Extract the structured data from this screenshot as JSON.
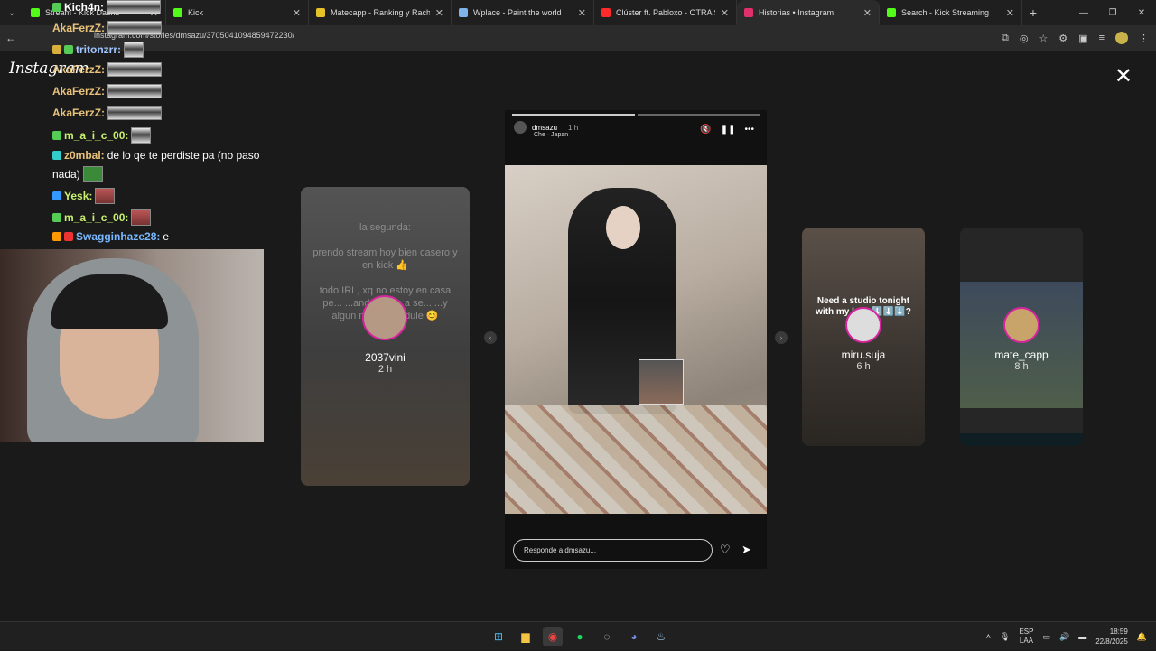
{
  "browser": {
    "tabs": [
      {
        "title": "Stream - Kick Dashb",
        "favicon_color": "#53fc18",
        "active": false
      },
      {
        "title": "Kick",
        "favicon_color": "#53fc18",
        "active": false
      },
      {
        "title": "Matecapp - Ranking y Racha d",
        "favicon_color": "#e6c229",
        "active": false
      },
      {
        "title": "Wplace - Paint the world",
        "favicon_color": "#7fb4e8",
        "active": false
      },
      {
        "title": "Clúster ft. Pabloxo - OTRA SED",
        "favicon_color": "#ff2a2a",
        "active": false
      },
      {
        "title": "Historias • Instagram",
        "favicon_color": "#e1306c",
        "active": true
      },
      {
        "title": "Search - Kick Streaming",
        "favicon_color": "#53fc18",
        "active": false
      }
    ],
    "url": "instagram.com/stories/dmsazu/3705041094859472230/"
  },
  "instagram": {
    "logo": "Instagram",
    "left_story": {
      "lines": [
        "la segunda:",
        "prendo stream hoy bien casero y en kick 👍",
        "todo IRL, xq no estoy en casa pe... ...ando ya va a se... ...y algun minec... ...dule 😊"
      ],
      "username": "2037vini",
      "time": "2 h"
    },
    "main_story": {
      "username": "dmsazu",
      "time": "1 h",
      "song": "Che · Japan",
      "reply_placeholder": "Responde a dmsazu..."
    },
    "right_story_1": {
      "overlay_text": "Need a studio tonight with my l... ...⬇️⬇️⬇️?",
      "username": "miru.suja",
      "time": "6 h"
    },
    "right_story_2": {
      "username": "mate_capp",
      "time": "8 h"
    }
  },
  "chat": [
    {
      "user": "Kich4n:",
      "color": "#ffffff",
      "msg": ""
    },
    {
      "user": "AkaFerzZ:",
      "color": "#e8c27a",
      "msg": ""
    },
    {
      "user": "tritonzrr:",
      "color": "#9fc6ff",
      "msg": ""
    },
    {
      "user": "AkaFerzZ:",
      "color": "#e8c27a",
      "msg": ""
    },
    {
      "user": "AkaFerzZ:",
      "color": "#e8c27a",
      "msg": ""
    },
    {
      "user": "AkaFerzZ:",
      "color": "#e8c27a",
      "msg": ""
    },
    {
      "user": "m_a_i_c_00:",
      "color": "#c8f06e",
      "msg": ""
    },
    {
      "user": "z0mbal:",
      "color": "#e8c27a",
      "msg": "de lo qe te perdiste pa (no paso"
    },
    {
      "user": "",
      "color": "#ffffff",
      "msg": "nada)"
    },
    {
      "user": "Yesk:",
      "color": "#c8f06e",
      "msg": ""
    },
    {
      "user": "m_a_i_c_00:",
      "color": "#c8f06e",
      "msg": ""
    },
    {
      "user": "Swagginhaze28:",
      "color": "#7ab8ff",
      "msg": "e"
    }
  ],
  "taskbar": {
    "lang_top": "ESP",
    "lang_bottom": "LAA",
    "time": "18:59",
    "date": "22/8/2025"
  }
}
